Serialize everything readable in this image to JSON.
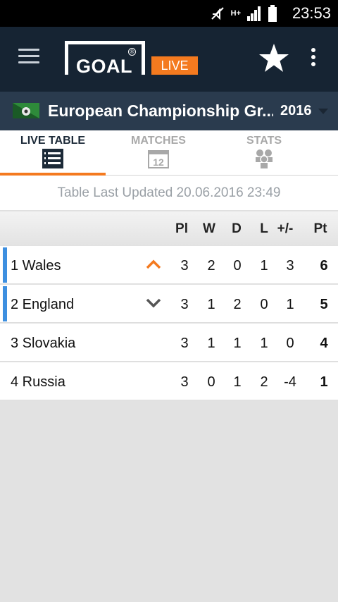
{
  "status_bar": {
    "time": "23:53",
    "network": "H+"
  },
  "app_bar": {
    "logo_text": "GOAL",
    "logo_badge": "LIVE"
  },
  "competition": {
    "title": "European Championship Gr...",
    "year": "2016"
  },
  "tabs": [
    {
      "label": "LIVE TABLE",
      "icon": "list-icon",
      "active": true
    },
    {
      "label": "MATCHES",
      "icon": "calendar-icon",
      "calendar_day": "12",
      "active": false
    },
    {
      "label": "STATS",
      "icon": "players-icon",
      "active": false
    }
  ],
  "table_updated": "Table Last Updated 20.06.2016 23:49",
  "table": {
    "columns": [
      "Pl",
      "W",
      "D",
      "L",
      "+/-",
      "Pt"
    ],
    "rows": [
      {
        "team": "1 Wales",
        "trend": "up",
        "pl": "3",
        "w": "2",
        "d": "0",
        "l": "1",
        "gd": "3",
        "pt": "6",
        "qualified": true
      },
      {
        "team": "2 England",
        "trend": "down",
        "pl": "3",
        "w": "1",
        "d": "2",
        "l": "0",
        "gd": "1",
        "pt": "5",
        "qualified": true
      },
      {
        "team": "3 Slovakia",
        "trend": "",
        "pl": "3",
        "w": "1",
        "d": "1",
        "l": "1",
        "gd": "0",
        "pt": "4",
        "qualified": false
      },
      {
        "team": "4 Russia",
        "trend": "",
        "pl": "3",
        "w": "0",
        "d": "1",
        "l": "2",
        "gd": "-4",
        "pt": "1",
        "qualified": false
      }
    ]
  },
  "colors": {
    "accent": "#f47a1f",
    "app_bar": "#162433",
    "competition_bar": "#2a3b4e",
    "qualified_marker": "#3d8fe0"
  }
}
